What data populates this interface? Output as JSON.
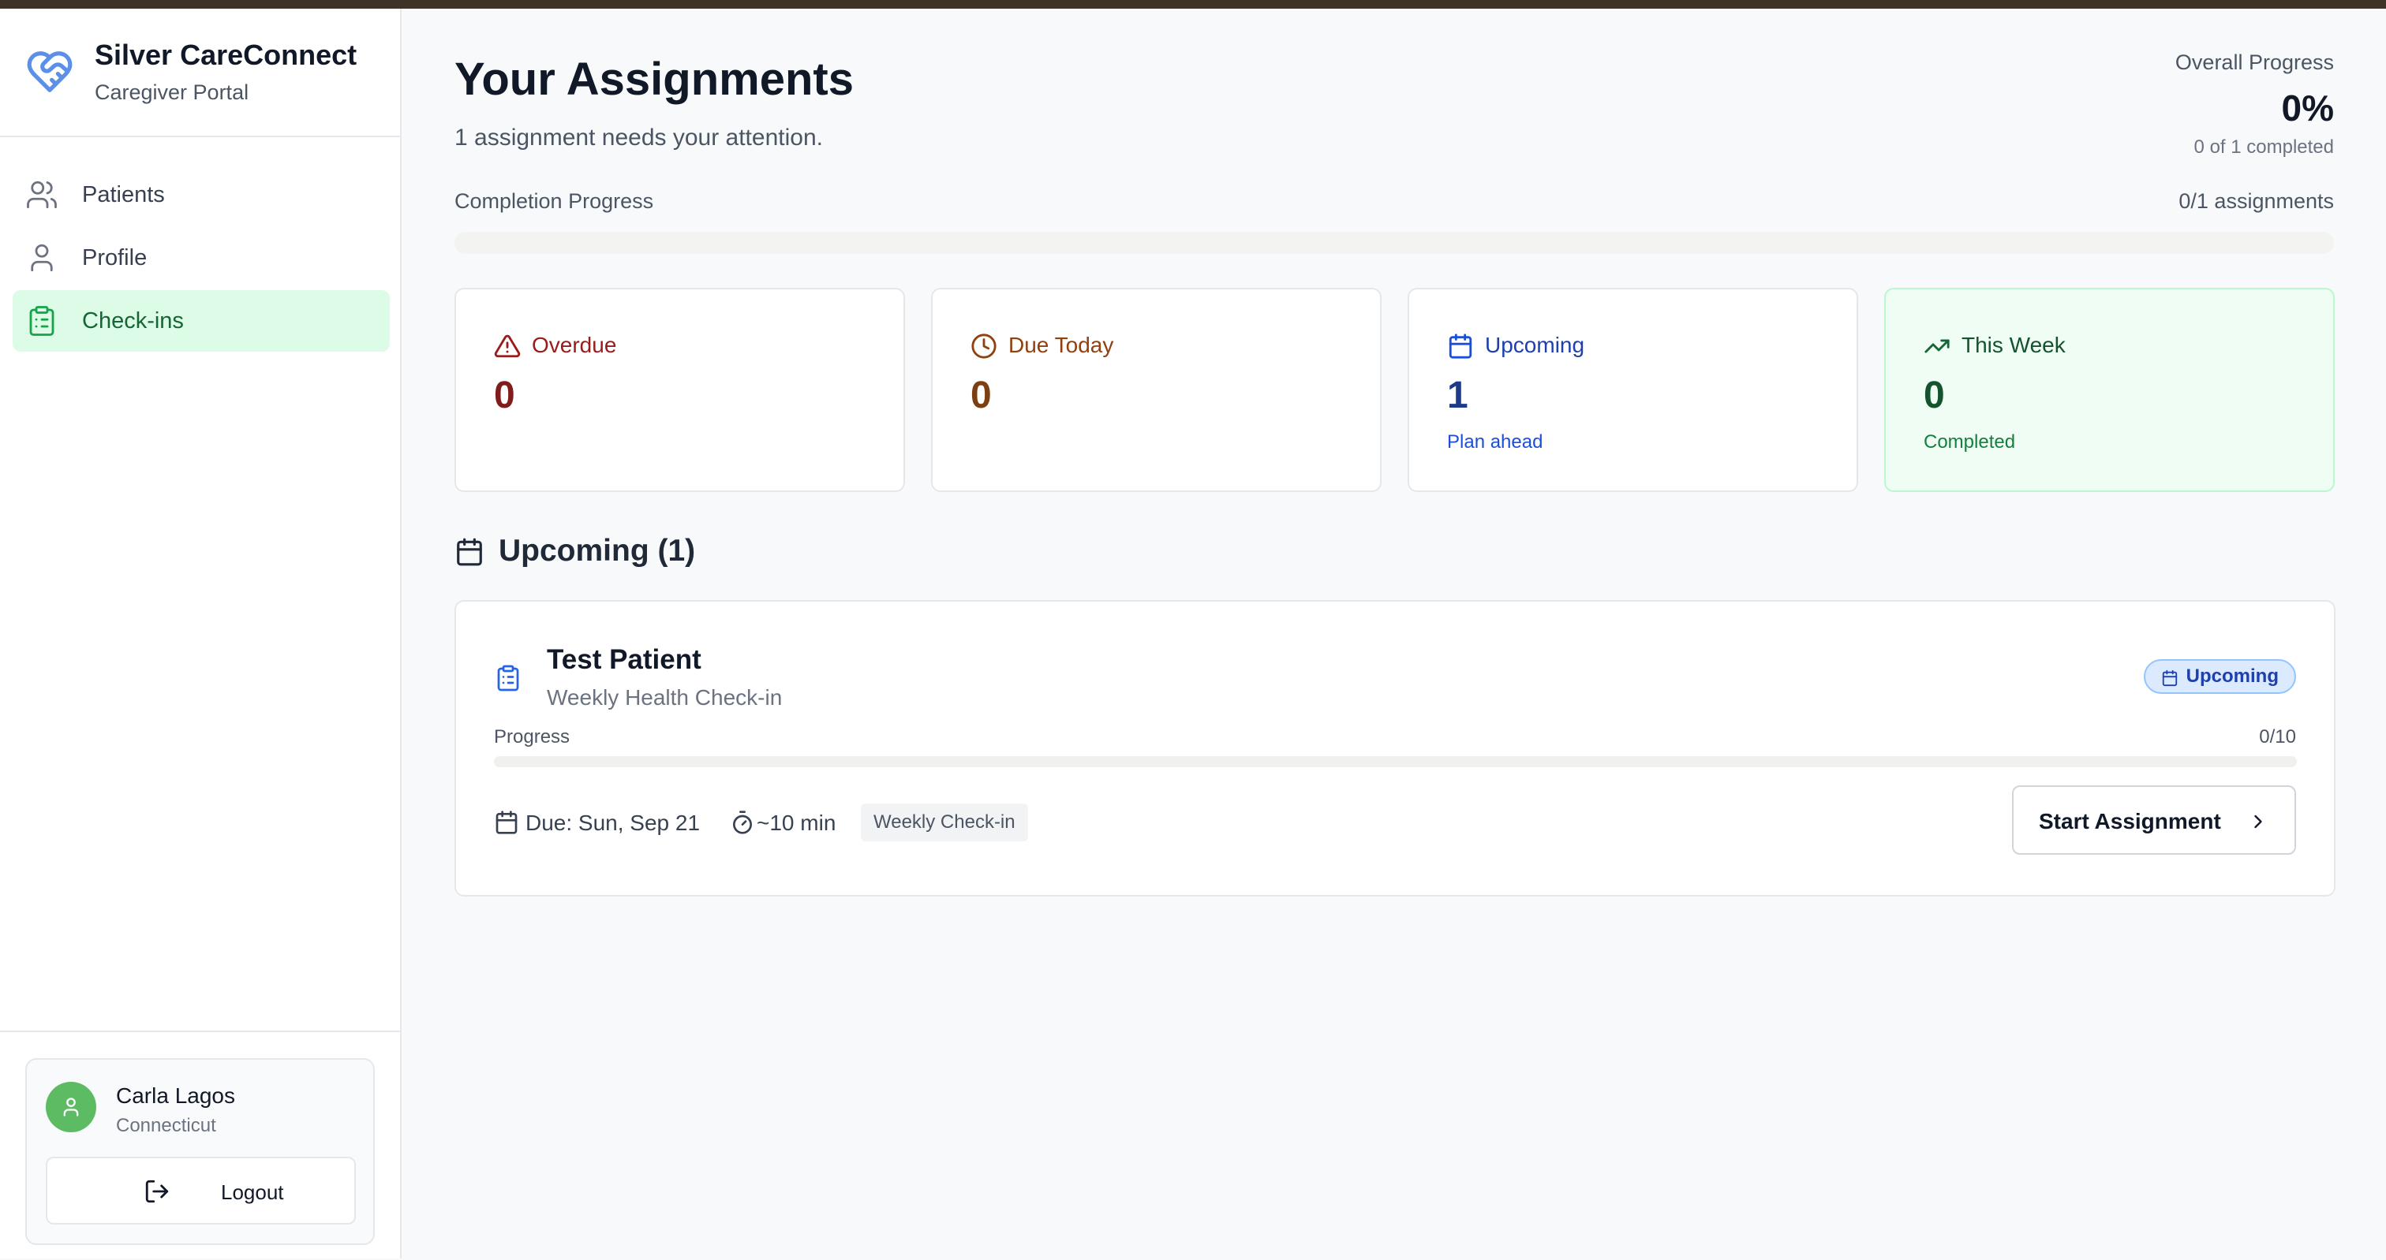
{
  "app": {
    "title": "Silver CareConnect",
    "subtitle": "Caregiver Portal"
  },
  "sidebar": {
    "items": [
      {
        "label": "Patients",
        "icon": "users-icon"
      },
      {
        "label": "Profile",
        "icon": "user-icon"
      },
      {
        "label": "Check-ins",
        "icon": "clipboard-icon",
        "active": true
      }
    ]
  },
  "user": {
    "name": "Carla Lagos",
    "state": "Connecticut",
    "logout_label": "Logout"
  },
  "header": {
    "title": "Your Assignments",
    "subtitle": "1 assignment needs your attention.",
    "overall_label": "Overall Progress",
    "overall_value": "0%",
    "overall_sub": "0 of 1 completed"
  },
  "completion": {
    "label": "Completion Progress",
    "count": "0/1 assignments",
    "fraction": 0
  },
  "stats": [
    {
      "title": "Overdue",
      "value": "0",
      "sub": "",
      "color": "#991b1b",
      "icon": "alert-triangle-icon"
    },
    {
      "title": "Due Today",
      "value": "0",
      "sub": "",
      "color": "#92400e",
      "icon": "clock-icon"
    },
    {
      "title": "Upcoming",
      "value": "1",
      "sub": "Plan ahead",
      "color": "#1e3a8a",
      "icon": "calendar-icon"
    },
    {
      "title": "This Week",
      "value": "0",
      "sub": "Completed",
      "color": "#14532d",
      "icon": "trending-up-icon"
    }
  ],
  "section": {
    "title": "Upcoming (1)"
  },
  "assignment": {
    "patient": "Test Patient",
    "type": "Weekly Health Check-in",
    "badge": "Upcoming",
    "progress_label": "Progress",
    "progress_count": "0/10",
    "progress_fraction": 0,
    "due": "Due: Sun, Sep 21",
    "duration": "~10 min",
    "tag": "Weekly Check-in",
    "start_label": "Start Assignment"
  },
  "colors": {
    "accent": "#22c55e",
    "active_nav_bg": "#dcfce7",
    "brand_blue": "#5b8fe8"
  }
}
